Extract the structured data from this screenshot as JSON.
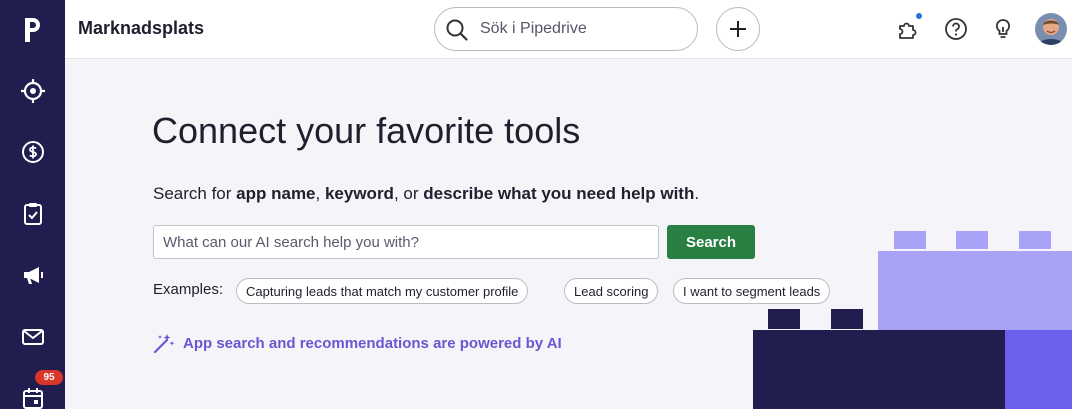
{
  "sidebar": {
    "logo": "p",
    "items": [
      {
        "name": "leads",
        "icon": "target-icon"
      },
      {
        "name": "deals",
        "icon": "dollar-icon"
      },
      {
        "name": "activities",
        "icon": "clipboard-check-icon"
      },
      {
        "name": "campaigns",
        "icon": "megaphone-icon"
      },
      {
        "name": "mail",
        "icon": "mail-icon"
      },
      {
        "name": "calendar",
        "icon": "calendar-icon",
        "badge": "95"
      }
    ]
  },
  "header": {
    "title": "Marknadsplats",
    "search_placeholder": "Sök i Pipedrive",
    "icons": [
      "plus-icon",
      "puzzle-icon",
      "help-icon",
      "lightbulb-icon",
      "avatar"
    ]
  },
  "main": {
    "heading": "Connect your favorite tools",
    "subtext": {
      "part1": "Search for ",
      "bold1": "app name",
      "part2": ", ",
      "bold2": "keyword",
      "part3": ", or ",
      "bold3": "describe what you need help with",
      "part4": "."
    },
    "search_placeholder": "What can our AI search help you with?",
    "search_button": "Search",
    "examples_label": "Examples:",
    "examples": [
      "Capturing leads that match my customer profile",
      "Lead scoring",
      "I want to segment leads"
    ],
    "ai_note": "App search and recommendations are powered by AI"
  },
  "colors": {
    "sidebar": "#221d4f",
    "primary_button": "#2a8043",
    "ai_accent": "#6a56d2",
    "block_light": "#a9a3f7",
    "block_mid": "#6c61ef",
    "block_dark": "#221d4f"
  }
}
